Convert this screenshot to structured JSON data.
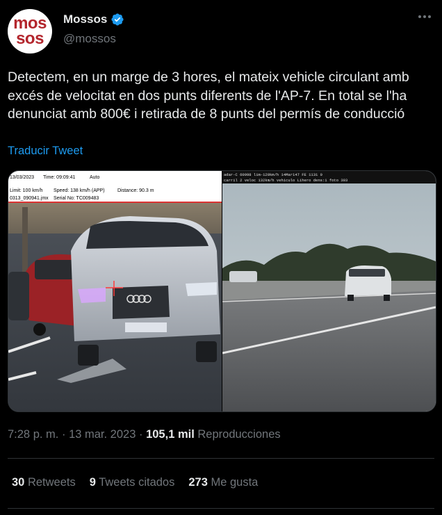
{
  "author": {
    "avatar_line1": "mos",
    "avatar_line2": "sos",
    "display_name": "Mossos",
    "handle": "@mossos",
    "verified": true
  },
  "tweet": {
    "text": "Detectem, en un marge de 3 hores, el mateix vehicle circulant amb excés de velocitat en dos punts diferents de l'AP-7. En total se l'ha denunciat amb 800€ i retirada de 8 punts del permís de conducció",
    "translate_label": "Traducir Tweet"
  },
  "media": {
    "left_photo": {
      "overlay": {
        "date": "13/03/2023",
        "time": "Time: 09:09:41",
        "mode": "Auto",
        "limit": "Limit: 100 km/h",
        "speed": "Speed: 138 km/h (APP)",
        "distance": "Distance: 90.3 m",
        "file": "0313_090941.jmx",
        "serial": "Serial No: TC009483"
      }
    },
    "right_photo": {
      "overlay": {
        "line1": "adar-C 60998 lim-120km/h 14Mar147 FE 1131 0",
        "line2": "carril 2 veloc 132km/h vehiculo Lihero dens:1 foto 303"
      }
    }
  },
  "meta": {
    "time": "7:28 p. m.",
    "date": "13 mar. 2023",
    "views_count": "105,1 mil",
    "views_label": "Reproducciones",
    "separator": "·"
  },
  "stats": {
    "retweets_count": "30",
    "retweets_label": "Retweets",
    "quotes_count": "9",
    "quotes_label": "Tweets citados",
    "likes_count": "273",
    "likes_label": "Me gusta"
  },
  "colors": {
    "background": "#000000",
    "text": "#e7e9ea",
    "secondary": "#71767b",
    "link": "#1d9bf0",
    "verified": "#1d9bf0",
    "brand_red": "#b3262d"
  }
}
